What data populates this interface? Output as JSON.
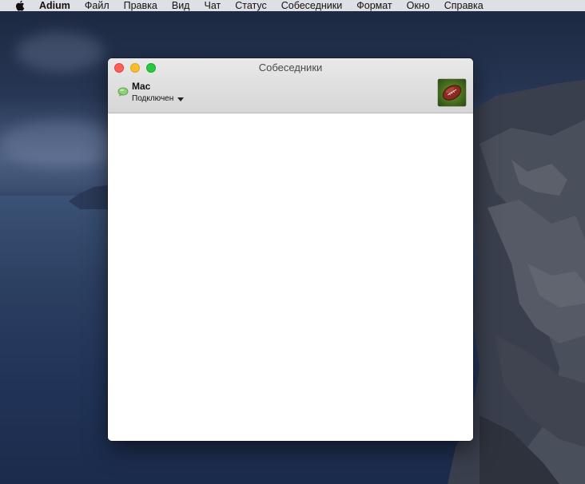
{
  "menubar": {
    "app_name": "Adium",
    "items": [
      "Файл",
      "Правка",
      "Вид",
      "Чат",
      "Статус",
      "Собеседники",
      "Формат",
      "Окно",
      "Справка"
    ]
  },
  "window": {
    "title": "Собеседники",
    "account": {
      "name": "Mac",
      "status": "Подключен",
      "status_icon": "green-speech-bubble-icon",
      "avatar_icon": "football-avatar-icon"
    },
    "contacts": []
  },
  "colors": {
    "traffic_close": "#fe5f57",
    "traffic_minimize": "#febc2e",
    "traffic_zoom": "#28c840",
    "status_available": "#7cc96a"
  }
}
